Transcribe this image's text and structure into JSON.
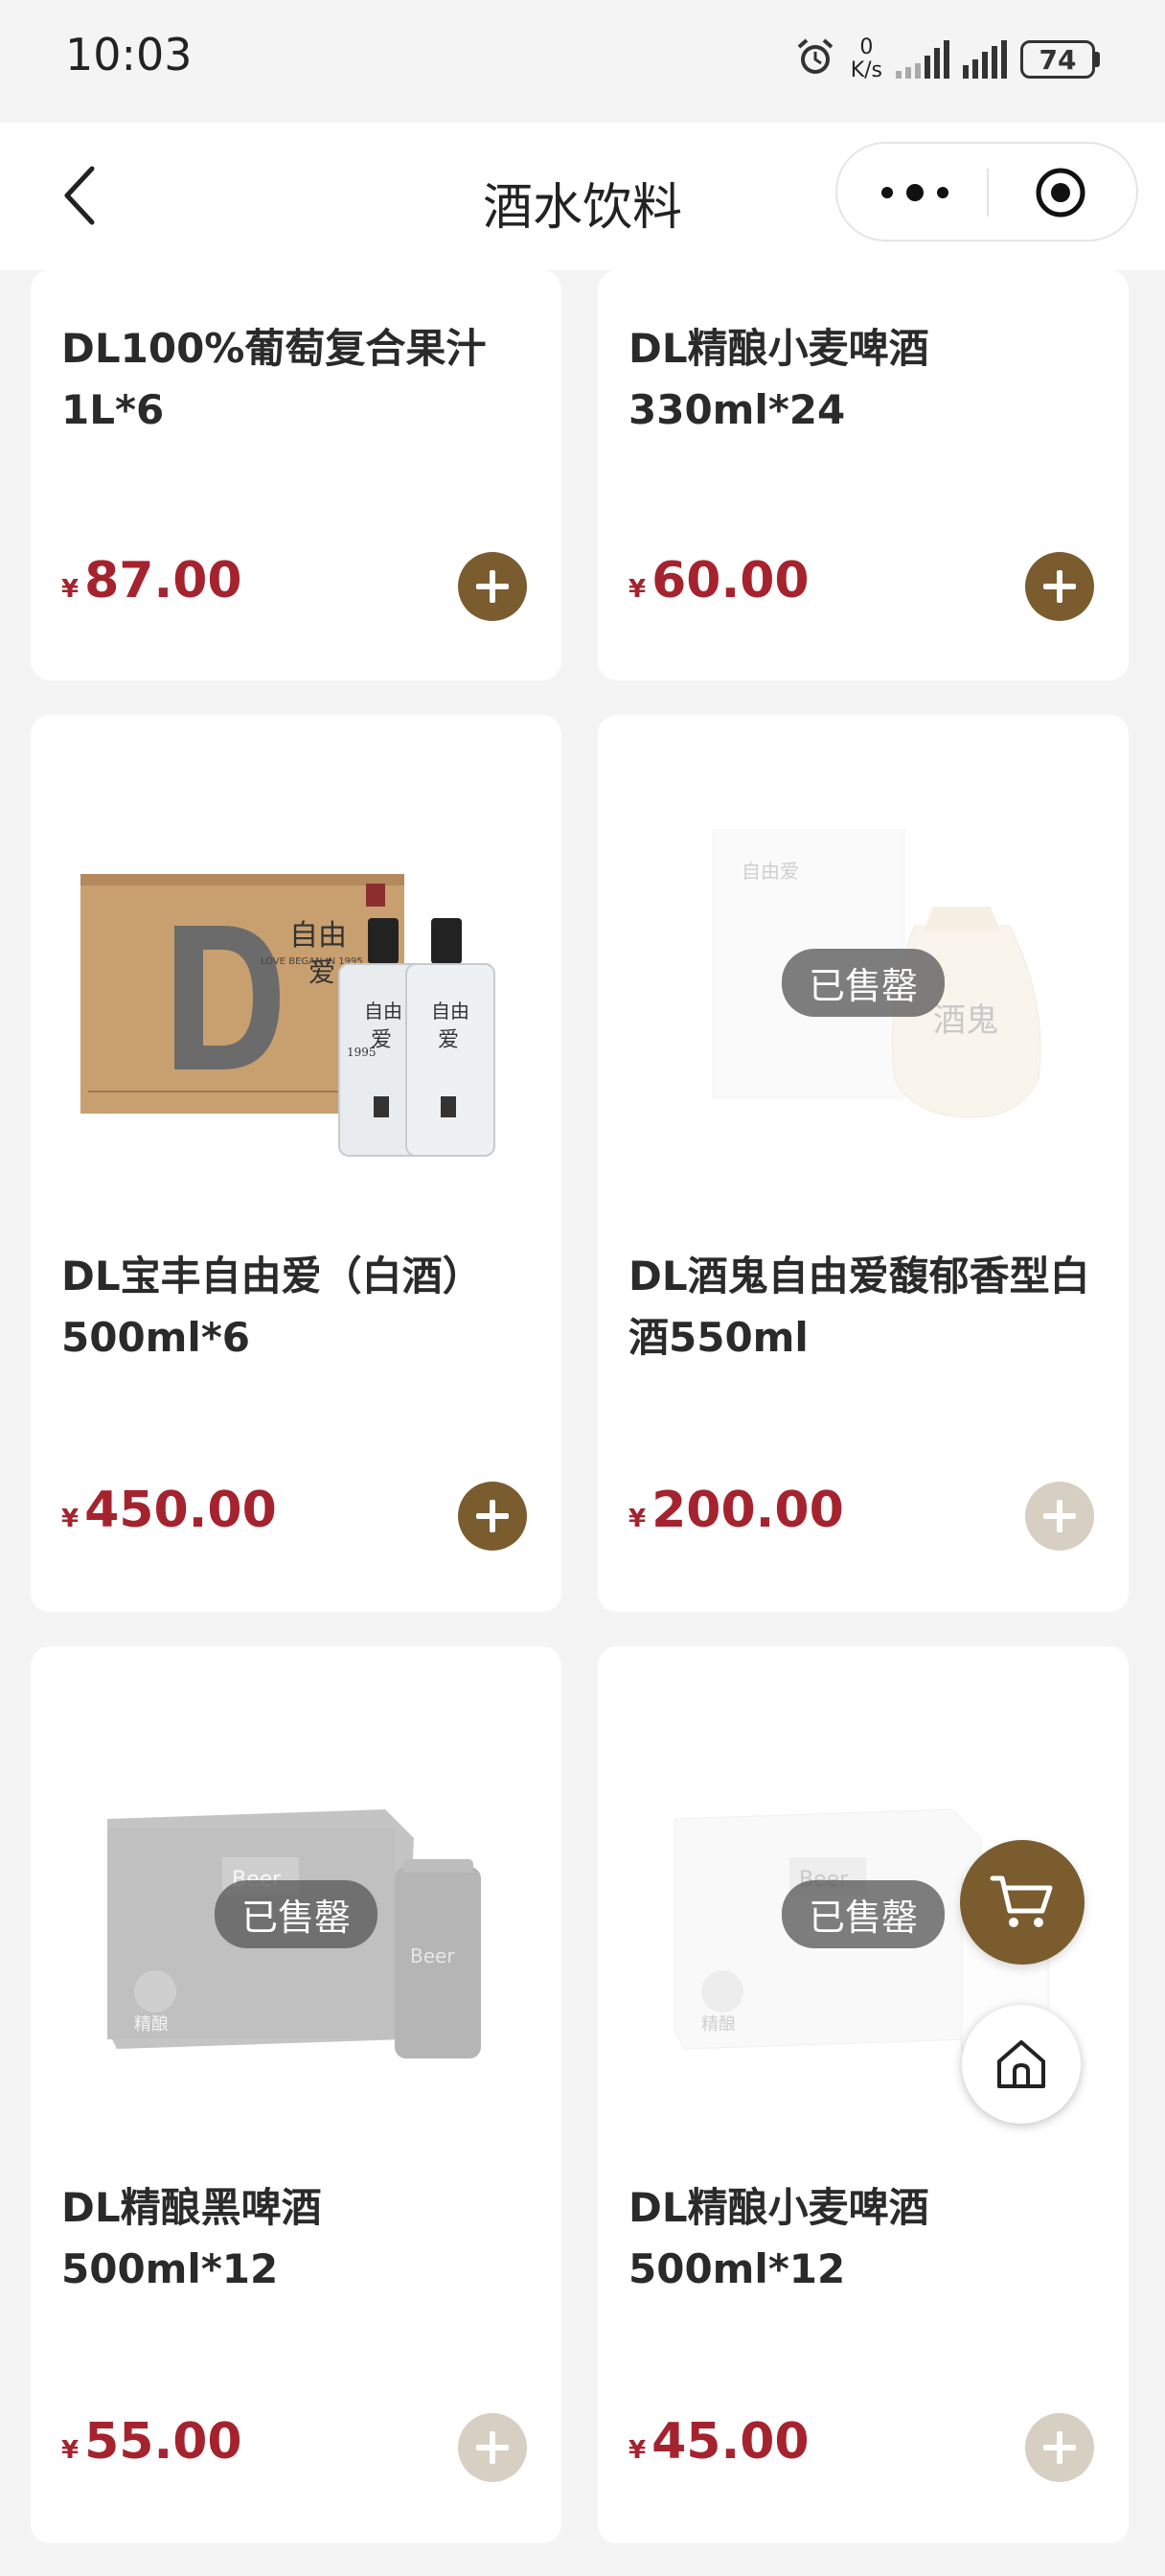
{
  "status_bar": {
    "time": "10:03",
    "net_speed_value": "0",
    "net_speed_unit": "K/s",
    "battery": "74",
    "icons": [
      "alarm-icon",
      "signal-icon",
      "battery-icon"
    ]
  },
  "nav": {
    "title": "酒水饮料",
    "icons": [
      "back-icon",
      "more-icon",
      "target-icon"
    ]
  },
  "colors": {
    "accent": "#7a5c2e",
    "price": "#a5232e",
    "disabled": "#d8cfc3"
  },
  "sold_out_label": "已售罄",
  "products": [
    {
      "name": "DL100%葡萄复合果汁1L*6",
      "currency": "¥",
      "price": "87.00",
      "sold_out": false
    },
    {
      "name": "DL精酿小麦啤酒330ml*24",
      "currency": "¥",
      "price": "60.00",
      "sold_out": false
    },
    {
      "name": "DL宝丰自由爱（白酒）500ml*6",
      "currency": "¥",
      "price": "450.00",
      "sold_out": false
    },
    {
      "name": "DL酒鬼自由爱馥郁香型白酒550ml",
      "currency": "¥",
      "price": "200.00",
      "sold_out": true
    },
    {
      "name": "DL精酿黑啤酒500ml*12",
      "currency": "¥",
      "price": "55.00",
      "sold_out": true
    },
    {
      "name": "DL精酿小麦啤酒500ml*12",
      "currency": "¥",
      "price": "45.00",
      "sold_out": true
    }
  ],
  "product_images": {
    "baofeng": {
      "box_text": "LOVE BEGAN IN 1995",
      "bottle_text": "自由爱",
      "year": "1995"
    },
    "jiugui": {
      "box_text": "自由爱",
      "jar_text": "酒鬼"
    },
    "beer_label": "精酿",
    "beer_brand": "Beer"
  },
  "floating": {
    "cart_icon": "cart-icon",
    "home_icon": "home-icon"
  }
}
